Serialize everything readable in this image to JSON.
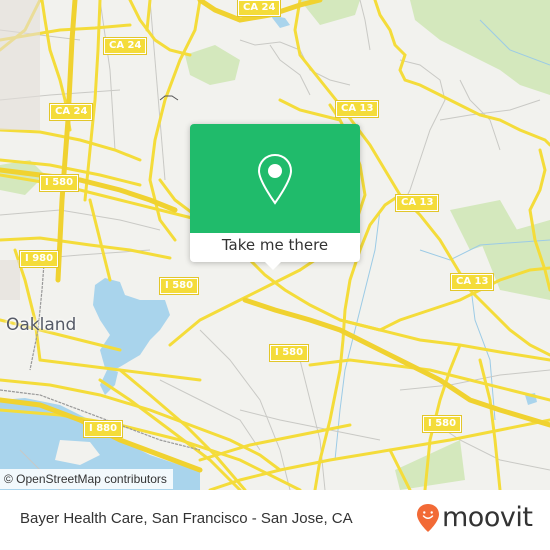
{
  "map": {
    "city_label": "Oakland",
    "road_shields": [
      {
        "id": "ca24-top",
        "label": "CA 24"
      },
      {
        "id": "ca24-left",
        "label": "CA 24"
      },
      {
        "id": "ca24-mid",
        "label": "CA 24"
      },
      {
        "id": "ca13-top",
        "label": "CA 13"
      },
      {
        "id": "ca13-mid",
        "label": "CA 13"
      },
      {
        "id": "ca13-right",
        "label": "CA 13"
      },
      {
        "id": "i580-left",
        "label": "I 580"
      },
      {
        "id": "i980",
        "label": "I 980"
      },
      {
        "id": "i580-center",
        "label": "I 580"
      },
      {
        "id": "i580-bottom",
        "label": "I 580"
      },
      {
        "id": "i580-right",
        "label": "I 580"
      },
      {
        "id": "i880",
        "label": "I 880"
      }
    ],
    "attribution": "© OpenStreetMap contributors",
    "colors": {
      "land": "#f2f2ee",
      "water": "#a9d4ec",
      "park": "#cfe6b4",
      "major_road": "#f4dc3a",
      "minor_road": "#c8c8c4"
    }
  },
  "popup": {
    "icon": "map-pin-icon",
    "button_label": "Take me there",
    "color": "#20bb6b"
  },
  "footer": {
    "caption": "Bayer Health Care, San Francisco - San Jose, CA",
    "brand": "moovit",
    "brand_color": "#f26a36"
  }
}
